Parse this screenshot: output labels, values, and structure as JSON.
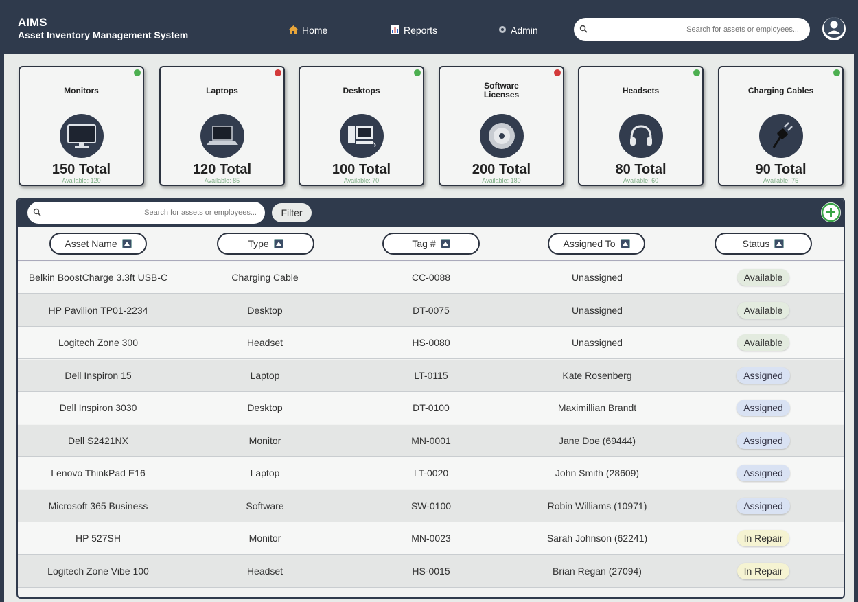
{
  "header": {
    "app_name": "AIMS",
    "app_subtitle": "Asset Inventory Management System",
    "nav": [
      {
        "label": "Home",
        "icon": "home-icon"
      },
      {
        "label": "Reports",
        "icon": "chart-icon"
      },
      {
        "label": "Admin",
        "icon": "gear-icon"
      }
    ],
    "search_placeholder": "Search for assets or employees...",
    "avatar_icon": "user-icon"
  },
  "categories": [
    {
      "name": "Monitors",
      "total": "150 Total",
      "available": "Available: 120",
      "status_color": "#4caf50",
      "icon": "monitor-icon"
    },
    {
      "name": "Laptops",
      "total": "120 Total",
      "available": "Available: 85",
      "status_color": "#d33a3a",
      "icon": "laptop-icon"
    },
    {
      "name": "Desktops",
      "total": "100 Total",
      "available": "Available: 70",
      "status_color": "#4caf50",
      "icon": "desktop-icon"
    },
    {
      "name": "Software Licenses",
      "total": "200 Total",
      "available": "Available: 180",
      "status_color": "#d33a3a",
      "icon": "disc-icon"
    },
    {
      "name": "Headsets",
      "total": "80 Total",
      "available": "Available: 60",
      "status_color": "#4caf50",
      "icon": "headset-icon"
    },
    {
      "name": "Charging Cables",
      "total": "90 Total",
      "available": "Available: 75",
      "status_color": "#4caf50",
      "icon": "cable-icon"
    }
  ],
  "table": {
    "search_placeholder": "Search for assets or employees...",
    "filter_label": "Filter",
    "columns": [
      "Asset Name",
      "Type",
      "Tag #",
      "Assigned To",
      "Status"
    ],
    "rows": [
      {
        "name": "Belkin BoostCharge 3.3ft USB-C",
        "type": "Charging Cable",
        "tag": "CC-0088",
        "assigned": "Unassigned",
        "status": "Available"
      },
      {
        "name": "HP Pavilion TP01-2234",
        "type": "Desktop",
        "tag": "DT-0075",
        "assigned": "Unassigned",
        "status": "Available"
      },
      {
        "name": "Logitech Zone 300",
        "type": "Headset",
        "tag": "HS-0080",
        "assigned": "Unassigned",
        "status": "Available"
      },
      {
        "name": "Dell Inspiron 15",
        "type": "Laptop",
        "tag": "LT-0115",
        "assigned": "Kate Rosenberg",
        "status": "Assigned"
      },
      {
        "name": "Dell Inspiron 3030",
        "type": "Desktop",
        "tag": "DT-0100",
        "assigned": "Maximillian Brandt",
        "status": "Assigned"
      },
      {
        "name": "Dell S2421NX",
        "type": "Monitor",
        "tag": "MN-0001",
        "assigned": "Jane Doe (69444)",
        "status": "Assigned"
      },
      {
        "name": "Lenovo ThinkPad E16",
        "type": "Laptop",
        "tag": "LT-0020",
        "assigned": "John Smith (28609)",
        "status": "Assigned"
      },
      {
        "name": "Microsoft 365 Business",
        "type": "Software",
        "tag": "SW-0100",
        "assigned": "Robin Williams (10971)",
        "status": "Assigned"
      },
      {
        "name": "HP 527SH",
        "type": "Monitor",
        "tag": "MN-0023",
        "assigned": "Sarah Johnson (62241)",
        "status": "In Repair"
      },
      {
        "name": "Logitech Zone Vibe 100",
        "type": "Headset",
        "tag": "HS-0015",
        "assigned": "Brian Regan (27094)",
        "status": "In Repair"
      }
    ]
  },
  "colors": {
    "header_bg": "#2f3a4c",
    "available_badge": "#e3ebdf",
    "assigned_badge": "#d9e2f3",
    "in_repair_badge": "#f5f3d2",
    "add_accent": "#3aa547"
  }
}
